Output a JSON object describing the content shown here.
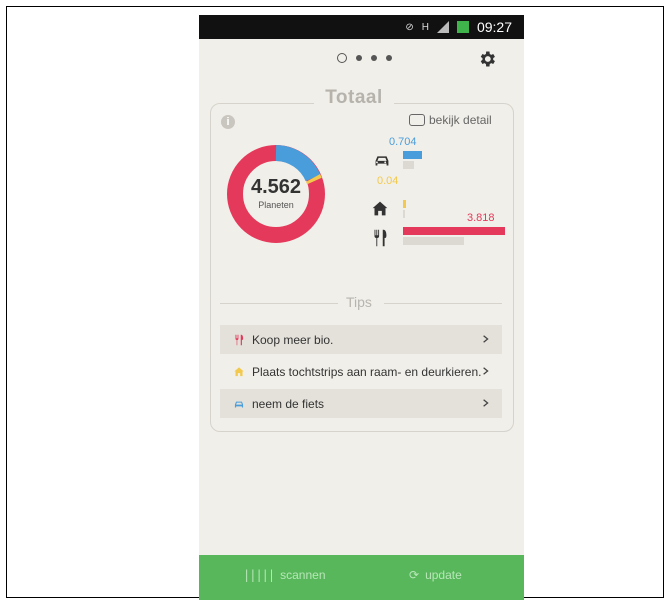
{
  "status": {
    "time": "09:27",
    "network": "H"
  },
  "header": {
    "pager_active_index": 0,
    "pager_count": 4
  },
  "card": {
    "title": "Totaal",
    "info_label": "i",
    "detail_label": "bekijk detail",
    "total_value": "4.562",
    "total_unit": "Planeten"
  },
  "chart_data": {
    "type": "bar",
    "categories": [
      "auto",
      "huis",
      "eten"
    ],
    "values": [
      0.704,
      0.04,
      3.818
    ],
    "value_labels": [
      "0.704",
      "0.04",
      "3.818"
    ],
    "colors": [
      "#4a9ddb",
      "#f2c94c",
      "#e5395b"
    ]
  },
  "tips": {
    "title": "Tips",
    "items": [
      {
        "label": "Koop meer bio."
      },
      {
        "label": "Plaats tochtstrips aan raam- en deurkieren."
      },
      {
        "label": "neem de fiets"
      }
    ]
  },
  "bottom": {
    "scan_label": "scannen",
    "update_label": "update"
  },
  "colors": {
    "accent_red": "#e5395b",
    "accent_blue": "#4a9ddb",
    "accent_yellow": "#f2c94c",
    "bottom_green": "#57b75a"
  }
}
